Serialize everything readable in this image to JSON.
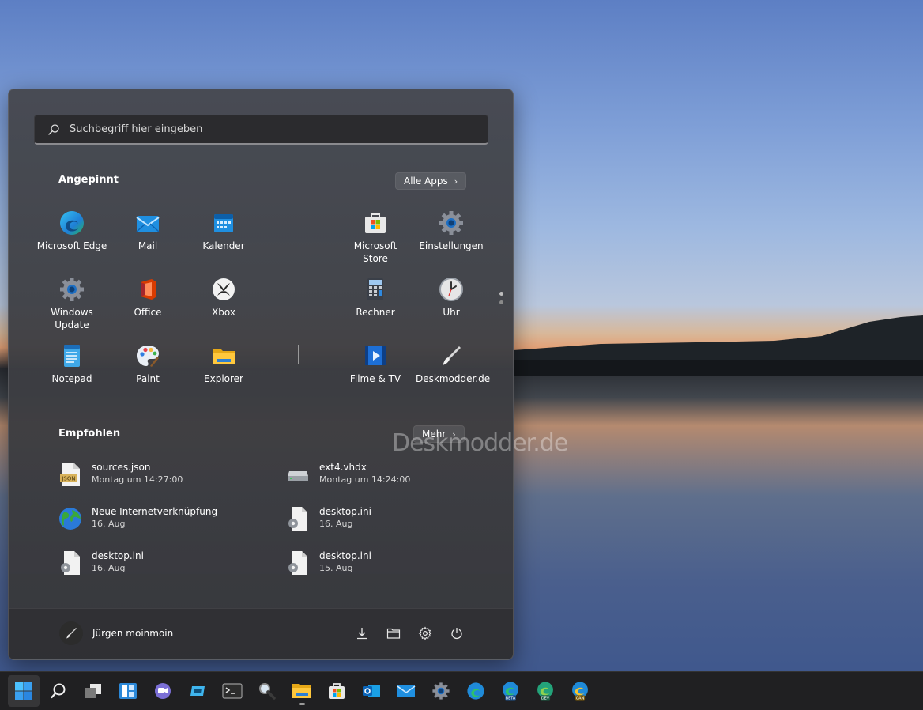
{
  "search": {
    "placeholder": "Suchbegriff hier eingeben"
  },
  "pinned": {
    "title": "Angepinnt",
    "all_apps_label": "Alle Apps",
    "apps": [
      {
        "label": "Microsoft Edge",
        "icon": "edge-icon"
      },
      {
        "label": "Mail",
        "icon": "mail-icon"
      },
      {
        "label": "Kalender",
        "icon": "calendar-icon"
      },
      {
        "label": "Microsoft Store",
        "icon": "store-icon"
      },
      {
        "label": "Einstellungen",
        "icon": "gear-icon"
      },
      {
        "label": "Windows Update",
        "icon": "gear-icon"
      },
      {
        "label": "Office",
        "icon": "office-icon"
      },
      {
        "label": "Xbox",
        "icon": "xbox-icon"
      },
      {
        "label": "Rechner",
        "icon": "calculator-icon"
      },
      {
        "label": "Uhr",
        "icon": "clock-icon"
      },
      {
        "label": "Notepad",
        "icon": "notepad-icon"
      },
      {
        "label": "Paint",
        "icon": "paint-icon"
      },
      {
        "label": "Explorer",
        "icon": "folder-icon"
      },
      {
        "label": "Filme & TV",
        "icon": "film-icon"
      },
      {
        "label": "Deskmodder.de",
        "icon": "brush-icon"
      }
    ]
  },
  "recommended": {
    "title": "Empfohlen",
    "more_label": "Mehr",
    "items": [
      {
        "name": "sources.json",
        "date": "Montag um 14:27:00",
        "icon": "json-file-icon"
      },
      {
        "name": "ext4.vhdx",
        "date": "Montag um 14:24:00",
        "icon": "drive-icon"
      },
      {
        "name": "Neue Internetverknüpfung",
        "date": "16. Aug",
        "icon": "globe-icon"
      },
      {
        "name": "desktop.ini",
        "date": "16. Aug",
        "icon": "settings-file-icon"
      },
      {
        "name": "desktop.ini",
        "date": "16. Aug",
        "icon": "settings-file-icon"
      },
      {
        "name": "desktop.ini",
        "date": "15. Aug",
        "icon": "settings-file-icon"
      }
    ]
  },
  "footer": {
    "user_name": "Jürgen moinmoin"
  },
  "watermark": "Deskmodder.de",
  "taskbar": [
    "windows-start-icon",
    "search-icon",
    "task-view-icon",
    "widgets-icon",
    "teams-chat-icon",
    "app-icon",
    "terminal-icon",
    "magnifier-icon",
    "explorer-icon",
    "store-icon",
    "outlook-icon",
    "mail-icon",
    "settings-icon",
    "edge-icon",
    "edge-beta-icon",
    "edge-dev-icon",
    "edge-canary-icon"
  ]
}
